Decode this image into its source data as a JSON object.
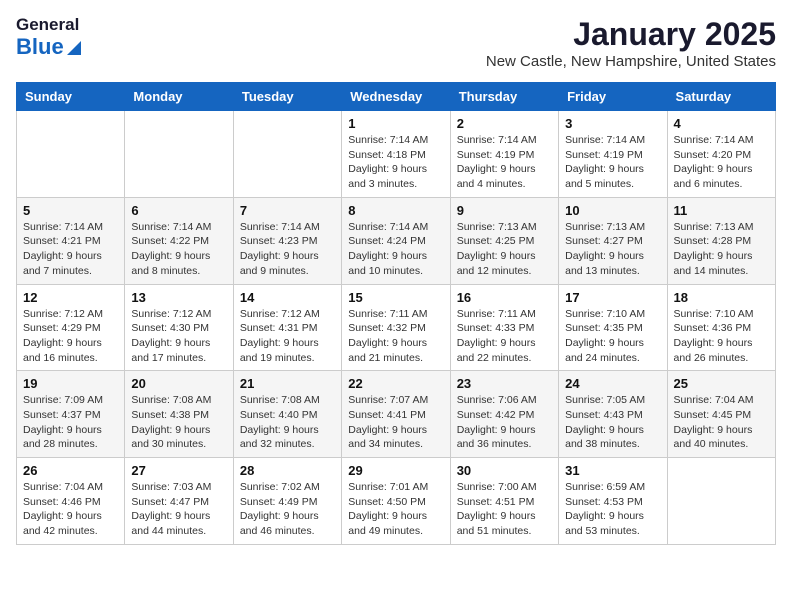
{
  "header": {
    "logo_general": "General",
    "logo_blue": "Blue",
    "month_title": "January 2025",
    "location": "New Castle, New Hampshire, United States"
  },
  "calendar": {
    "days_of_week": [
      "Sunday",
      "Monday",
      "Tuesday",
      "Wednesday",
      "Thursday",
      "Friday",
      "Saturday"
    ],
    "weeks": [
      [
        {
          "day": "",
          "info": ""
        },
        {
          "day": "",
          "info": ""
        },
        {
          "day": "",
          "info": ""
        },
        {
          "day": "1",
          "info": "Sunrise: 7:14 AM\nSunset: 4:18 PM\nDaylight: 9 hours and 3 minutes."
        },
        {
          "day": "2",
          "info": "Sunrise: 7:14 AM\nSunset: 4:19 PM\nDaylight: 9 hours and 4 minutes."
        },
        {
          "day": "3",
          "info": "Sunrise: 7:14 AM\nSunset: 4:19 PM\nDaylight: 9 hours and 5 minutes."
        },
        {
          "day": "4",
          "info": "Sunrise: 7:14 AM\nSunset: 4:20 PM\nDaylight: 9 hours and 6 minutes."
        }
      ],
      [
        {
          "day": "5",
          "info": "Sunrise: 7:14 AM\nSunset: 4:21 PM\nDaylight: 9 hours and 7 minutes."
        },
        {
          "day": "6",
          "info": "Sunrise: 7:14 AM\nSunset: 4:22 PM\nDaylight: 9 hours and 8 minutes."
        },
        {
          "day": "7",
          "info": "Sunrise: 7:14 AM\nSunset: 4:23 PM\nDaylight: 9 hours and 9 minutes."
        },
        {
          "day": "8",
          "info": "Sunrise: 7:14 AM\nSunset: 4:24 PM\nDaylight: 9 hours and 10 minutes."
        },
        {
          "day": "9",
          "info": "Sunrise: 7:13 AM\nSunset: 4:25 PM\nDaylight: 9 hours and 12 minutes."
        },
        {
          "day": "10",
          "info": "Sunrise: 7:13 AM\nSunset: 4:27 PM\nDaylight: 9 hours and 13 minutes."
        },
        {
          "day": "11",
          "info": "Sunrise: 7:13 AM\nSunset: 4:28 PM\nDaylight: 9 hours and 14 minutes."
        }
      ],
      [
        {
          "day": "12",
          "info": "Sunrise: 7:12 AM\nSunset: 4:29 PM\nDaylight: 9 hours and 16 minutes."
        },
        {
          "day": "13",
          "info": "Sunrise: 7:12 AM\nSunset: 4:30 PM\nDaylight: 9 hours and 17 minutes."
        },
        {
          "day": "14",
          "info": "Sunrise: 7:12 AM\nSunset: 4:31 PM\nDaylight: 9 hours and 19 minutes."
        },
        {
          "day": "15",
          "info": "Sunrise: 7:11 AM\nSunset: 4:32 PM\nDaylight: 9 hours and 21 minutes."
        },
        {
          "day": "16",
          "info": "Sunrise: 7:11 AM\nSunset: 4:33 PM\nDaylight: 9 hours and 22 minutes."
        },
        {
          "day": "17",
          "info": "Sunrise: 7:10 AM\nSunset: 4:35 PM\nDaylight: 9 hours and 24 minutes."
        },
        {
          "day": "18",
          "info": "Sunrise: 7:10 AM\nSunset: 4:36 PM\nDaylight: 9 hours and 26 minutes."
        }
      ],
      [
        {
          "day": "19",
          "info": "Sunrise: 7:09 AM\nSunset: 4:37 PM\nDaylight: 9 hours and 28 minutes."
        },
        {
          "day": "20",
          "info": "Sunrise: 7:08 AM\nSunset: 4:38 PM\nDaylight: 9 hours and 30 minutes."
        },
        {
          "day": "21",
          "info": "Sunrise: 7:08 AM\nSunset: 4:40 PM\nDaylight: 9 hours and 32 minutes."
        },
        {
          "day": "22",
          "info": "Sunrise: 7:07 AM\nSunset: 4:41 PM\nDaylight: 9 hours and 34 minutes."
        },
        {
          "day": "23",
          "info": "Sunrise: 7:06 AM\nSunset: 4:42 PM\nDaylight: 9 hours and 36 minutes."
        },
        {
          "day": "24",
          "info": "Sunrise: 7:05 AM\nSunset: 4:43 PM\nDaylight: 9 hours and 38 minutes."
        },
        {
          "day": "25",
          "info": "Sunrise: 7:04 AM\nSunset: 4:45 PM\nDaylight: 9 hours and 40 minutes."
        }
      ],
      [
        {
          "day": "26",
          "info": "Sunrise: 7:04 AM\nSunset: 4:46 PM\nDaylight: 9 hours and 42 minutes."
        },
        {
          "day": "27",
          "info": "Sunrise: 7:03 AM\nSunset: 4:47 PM\nDaylight: 9 hours and 44 minutes."
        },
        {
          "day": "28",
          "info": "Sunrise: 7:02 AM\nSunset: 4:49 PM\nDaylight: 9 hours and 46 minutes."
        },
        {
          "day": "29",
          "info": "Sunrise: 7:01 AM\nSunset: 4:50 PM\nDaylight: 9 hours and 49 minutes."
        },
        {
          "day": "30",
          "info": "Sunrise: 7:00 AM\nSunset: 4:51 PM\nDaylight: 9 hours and 51 minutes."
        },
        {
          "day": "31",
          "info": "Sunrise: 6:59 AM\nSunset: 4:53 PM\nDaylight: 9 hours and 53 minutes."
        },
        {
          "day": "",
          "info": ""
        }
      ]
    ]
  }
}
